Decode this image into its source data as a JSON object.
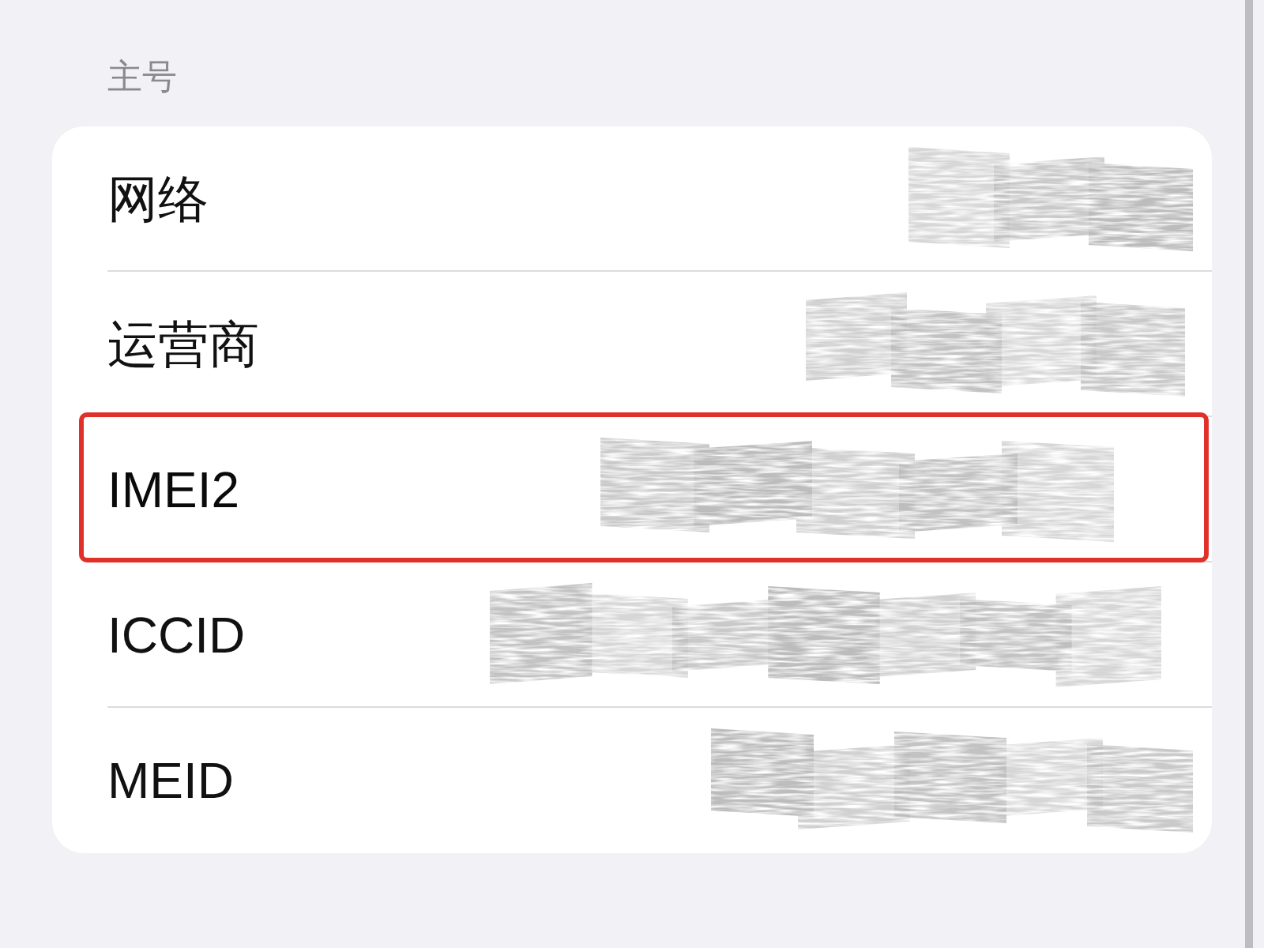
{
  "section": {
    "header": "主号",
    "rows": [
      {
        "label": "网络",
        "redacted": true,
        "highlighted": false
      },
      {
        "label": "运营商",
        "redacted": true,
        "highlighted": false
      },
      {
        "label": "IMEI2",
        "redacted": true,
        "highlighted": true
      },
      {
        "label": "ICCID",
        "redacted": true,
        "highlighted": false
      },
      {
        "label": "MEID",
        "redacted": true,
        "highlighted": false
      }
    ]
  }
}
